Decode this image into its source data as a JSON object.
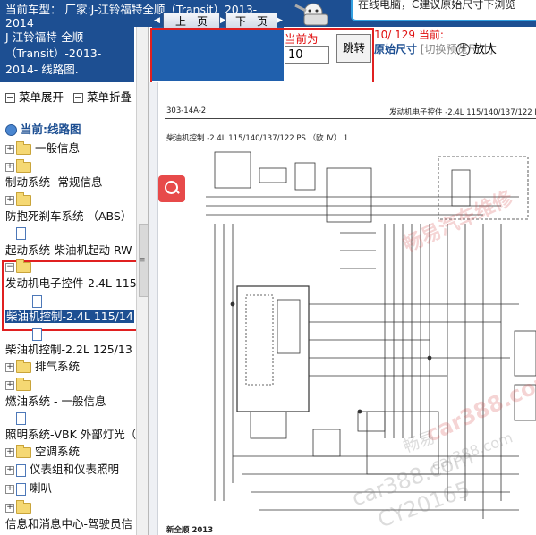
{
  "header": {
    "title": "当前车型： 厂家:J-江铃福特全顺（Transit）2013-2014",
    "tip": "在线电脑，C建议原始尺寸下浏览"
  },
  "sidebar": {
    "title": "J-江铃福特-全顺（Transit）-2013-2014- 线路图.",
    "expand_label": "菜单展开",
    "collapse_label": "菜单折叠",
    "current_label": "当前:线路图",
    "items": [
      {
        "label": "一般信息"
      },
      {
        "label": "制动系统- 常规信息"
      },
      {
        "label": "防抱死刹车系统 （ABS）"
      },
      {
        "label": "起动系统-柴油机起动 RW"
      },
      {
        "label": "发动机电子控件-2.4L 115"
      },
      {
        "label": "柴油机控制-2.4L 115/14"
      },
      {
        "label": "柴油机控制-2.2L 125/13"
      },
      {
        "label": "排气系统"
      },
      {
        "label": "燃油系统 - 一般信息"
      },
      {
        "label": "照明系统-VBK 外部灯光（"
      },
      {
        "label": "空调系统"
      },
      {
        "label": "仪表组和仪表照明"
      },
      {
        "label": "喇叭"
      },
      {
        "label": "信息和消息中心-驾驶员信"
      }
    ]
  },
  "toolbar": {
    "prev_label": "上一页",
    "next_label": "下一页",
    "current_label": "当前为",
    "page_value": "10",
    "jump_label": "跳转",
    "page_info": "10/ 129 当前:",
    "size_label": "原始尺寸",
    "size_hint": "[切换预览尺寸]",
    "zoom_label": "放大"
  },
  "diagram": {
    "code": "303-14A-2",
    "section": "发动机电子控件 -2.4L 115/140/137/122 PS",
    "subtitle": "柴油机控制 -2.4L 115/140/137/122 PS （欧 IV） 1",
    "footer": "新全顺 2013"
  },
  "watermarks": {
    "w1": "畅易汽车维修",
    "w2": "car388.com",
    "w3": "car388.com",
    "w4": "CY20165",
    "w5": "畅易",
    "w6": "car388.com"
  },
  "colors": {
    "header_bg": "#1d4f92",
    "nav_bg": "#2060ad",
    "highlight": "#e02020",
    "folder": "#f5d873"
  }
}
